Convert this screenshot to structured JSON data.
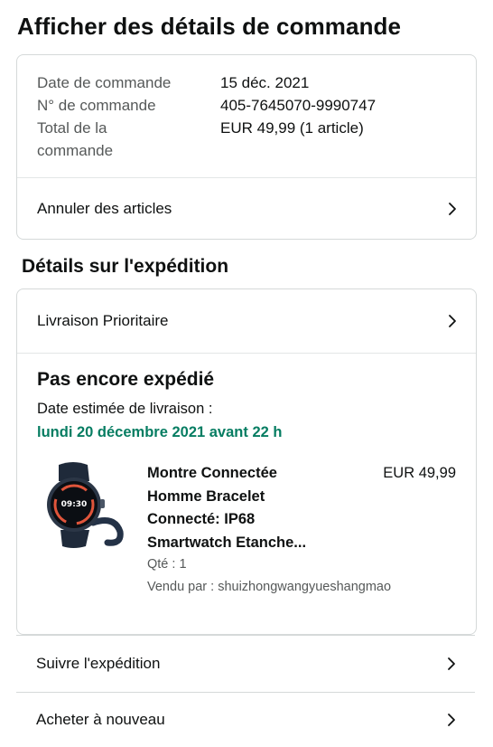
{
  "page": {
    "title": "Afficher des détails de commande"
  },
  "summary": {
    "order_date_label": "Date de commande",
    "order_date": "15 déc. 2021",
    "order_number_label": "N° de commande",
    "order_number": "405-7645070-9990747",
    "total_label_line1": "Total de la",
    "total_label_line2": "commande",
    "total": "EUR 49,99 (1 article)",
    "cancel_label": "Annuler des articles"
  },
  "shipping": {
    "section_title": "Détails sur l'expédition",
    "method": "Livraison Prioritaire",
    "status": "Pas encore expédié",
    "eta_label": "Date estimée de livraison :",
    "eta_date": "lundi 20 décembre 2021 avant 22 h",
    "status_color": "#067d62"
  },
  "product": {
    "title_lines": [
      "Montre Connectée",
      "Homme Bracelet",
      "Connecté: IP68",
      "Smartwatch Etanche..."
    ],
    "price": "EUR 49,99",
    "quantity": "Qté : 1",
    "seller": "Vendu par : shuizhongwangyueshangmao",
    "watch_time": "09:30"
  },
  "actions": {
    "track": "Suivre l'expédition",
    "buy_again": "Acheter à nouveau"
  },
  "icons": {
    "chevron": "chevron-right-icon"
  }
}
